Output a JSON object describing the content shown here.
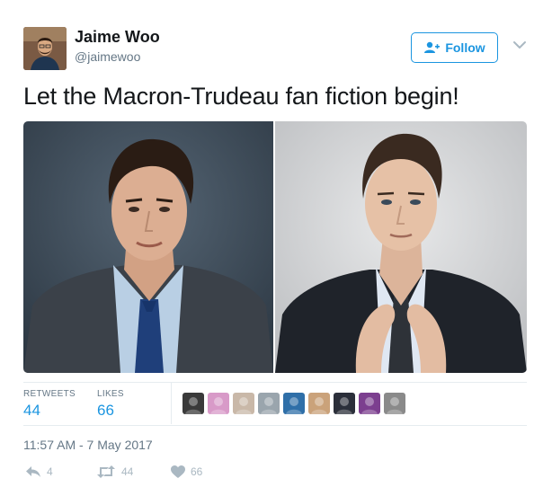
{
  "author": {
    "name": "Jaime Woo",
    "handle": "@jaimewoo"
  },
  "follow_label": "Follow",
  "tweet_text": "Let the Macron-Trudeau fan fiction begin!",
  "stats": {
    "retweets_label": "RETWEETS",
    "retweets_value": "44",
    "likes_label": "LIKES",
    "likes_value": "66"
  },
  "timestamp": "11:57 AM - 7 May 2017",
  "actions": {
    "reply_count": "4",
    "retweet_count": "44",
    "like_count": "66"
  },
  "colors": {
    "accent": "#1b95e0",
    "muted": "#657786",
    "action_gray": "#aab8c2"
  },
  "liker_colors": [
    "#3a3a3a",
    "#d89ac8",
    "#c9b8a8",
    "#9aa5ad",
    "#2f6fa8",
    "#caa27a",
    "#2b2f3a",
    "#7c3f8f",
    "#8a8a8a"
  ]
}
